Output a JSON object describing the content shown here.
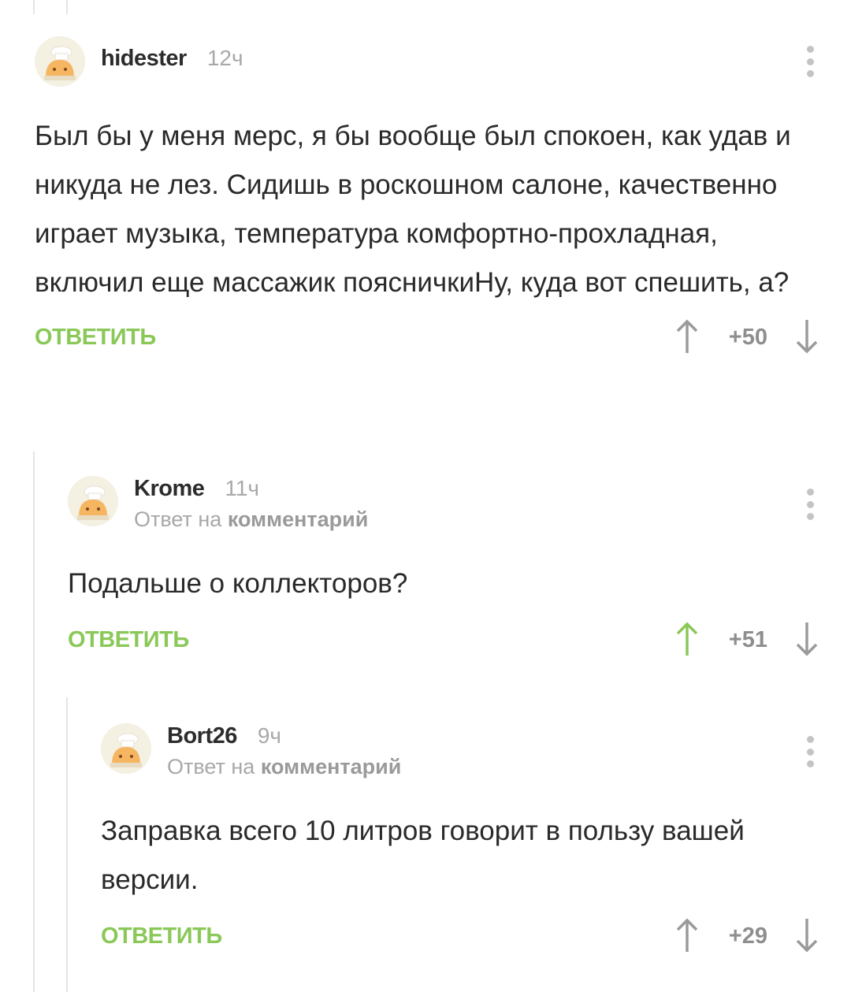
{
  "accent_color": "#8ac858",
  "comments": [
    {
      "author": "hidester",
      "time": "12ч",
      "text": "Был бы у меня мерс, я бы вообще был спокоен, как удав и никуда не лез. Сидишь в роскошном салоне, качественно играет музыка, температура комфортно-прохладная, включил еще массажик поясничкиНу, куда вот спешить, а?",
      "reply_label": "ОТВЕТИТЬ",
      "rating": "+50",
      "upvoted": false
    },
    {
      "author": "Krome",
      "time": "11ч",
      "reply_prefix": "Ответ на",
      "reply_target": "комментарий",
      "text": "Подальше о коллекторов?",
      "reply_label": "ОТВЕТИТЬ",
      "rating": "+51",
      "upvoted": true
    },
    {
      "author": "Bort26",
      "time": "9ч",
      "reply_prefix": "Ответ на",
      "reply_target": "комментарий",
      "text": "Заправка всего 10 литров говорит в пользу вашей версии.",
      "reply_label": "ОТВЕТИТЬ",
      "rating": "+29",
      "upvoted": false
    }
  ]
}
